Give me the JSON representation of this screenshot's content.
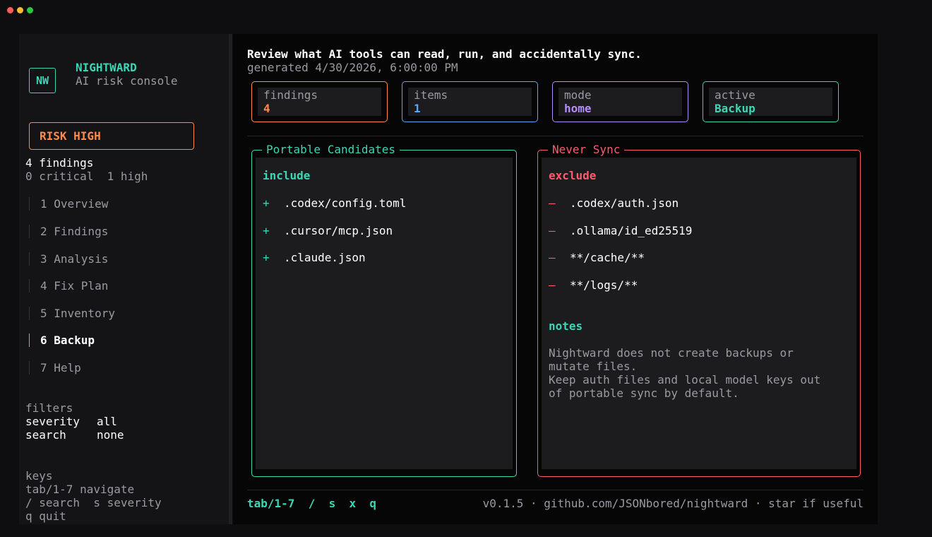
{
  "app": {
    "name": "NIGHTWARD",
    "subtitle": "AI risk console",
    "logo": "NW",
    "risk_label": "RISK HIGH",
    "findings_count": "4 findings",
    "severity_summary": "0 critical  1 high"
  },
  "nav": [
    {
      "label": "1 Overview",
      "active": false
    },
    {
      "label": "2 Findings",
      "active": false
    },
    {
      "label": "3 Analysis",
      "active": false
    },
    {
      "label": "4 Fix Plan",
      "active": false
    },
    {
      "label": "5 Inventory",
      "active": false
    },
    {
      "label": "6 Backup",
      "active": true
    },
    {
      "label": "7 Help",
      "active": false
    }
  ],
  "filters": {
    "heading": "filters",
    "severity_label": "severity",
    "severity_value": "all",
    "search_label": "search",
    "search_value": "none"
  },
  "keys": {
    "heading": "keys",
    "line1": "tab/1-7 navigate",
    "line2": "/ search  s severity",
    "line3": "q quit"
  },
  "header": {
    "title": "Review what AI tools can read, run, and accidentally sync.",
    "generated": "generated 4/30/2026, 6:00:00 PM"
  },
  "stats": [
    {
      "label": "findings",
      "value": "4",
      "color": "#ff8a4c"
    },
    {
      "label": "items",
      "value": "1",
      "color": "#5aa7ff"
    },
    {
      "label": "mode",
      "value": "home",
      "color": "#b58cff"
    },
    {
      "label": "active",
      "value": "Backup",
      "color": "#3dd6b5"
    }
  ],
  "portable": {
    "title": "Portable Candidates",
    "heading": "include",
    "symbol": "+",
    "items": [
      ".codex/config.toml",
      ".cursor/mcp.json",
      ".claude.json"
    ]
  },
  "never_sync": {
    "title": "Never Sync",
    "heading": "exclude",
    "symbol": "–",
    "items": [
      ".codex/auth.json",
      ".ollama/id_ed25519",
      "**/cache/**",
      "**/logs/**"
    ],
    "notes_heading": "notes",
    "notes": [
      "Nightward does not create backups or",
      "mutate files.",
      "Keep auth files and local model keys out",
      "of portable sync by default."
    ]
  },
  "footer": {
    "keys": "tab/1-7  /  s  x  q",
    "info": "v0.1.5 · github.com/JSONbored/nightward · star if useful"
  },
  "colors": {
    "accent": "#3dd6b5",
    "danger": "#ff5a6e",
    "warning": "#ff8a4c",
    "info": "#5aa7ff",
    "purple": "#b58cff"
  }
}
